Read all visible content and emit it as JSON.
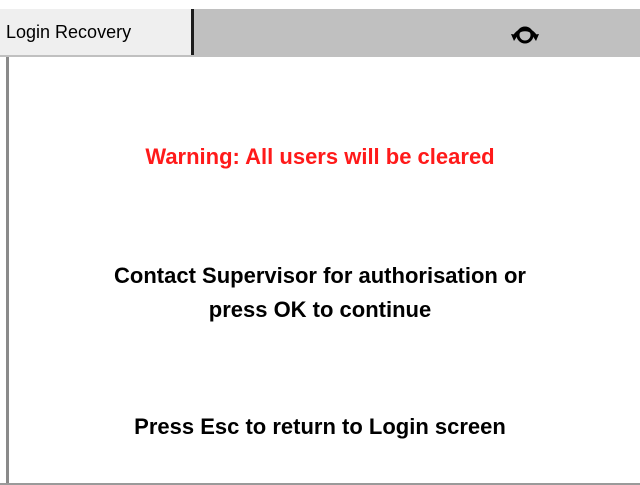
{
  "header": {
    "tab_label": "Login Recovery",
    "icon": "rotate-refresh-icon"
  },
  "messages": {
    "warning": "Warning: All users will be cleared",
    "contact_line1": "Contact Supervisor for authorisation or",
    "contact_line2": "press OK to continue",
    "escape": "Press Esc to return to Login screen"
  },
  "colors": {
    "warning_text": "#ff1a1a",
    "header_bar": "#c0c0c0",
    "tab_background": "#efefef"
  }
}
